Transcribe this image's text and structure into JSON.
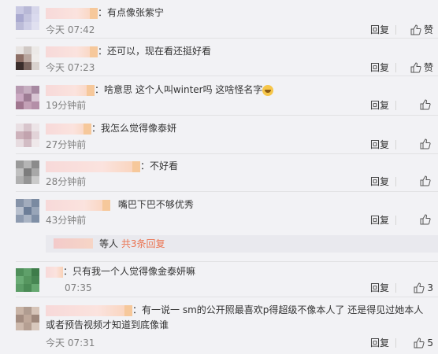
{
  "comments": [
    {
      "text": "有点像张紫宁",
      "time": "今天 07:42",
      "reply": "回复",
      "like": "赞",
      "avatar": [
        "#c8c8e2",
        "#b8b8d6",
        "#d6d6ea",
        "#a9a9cf",
        "#c4c4de",
        "#dadaee",
        "#bcbcd8",
        "#cfcfe6",
        "#e0e0f0"
      ]
    },
    {
      "text": "还可以，现在看还挺好看",
      "time": "今天 07:23",
      "reply": "回复",
      "like": "赞",
      "avatar": [
        "#e8e4e2",
        "#d0c8c4",
        "#ece9e7",
        "#8d6f66",
        "#b9a69e",
        "#efecea",
        "#3a2d2b",
        "#7a655f",
        "#d9d2ce"
      ]
    },
    {
      "text": "啥意思 这个人叫winter吗 这啥怪名字",
      "emoji": true,
      "time": "19分钟前",
      "reply": "回复",
      "like": "",
      "avatar": [
        "#b799b0",
        "#c6aec0",
        "#a789a1",
        "#caa8c1",
        "#9e7c94",
        "#d8c4d3",
        "#a0768f",
        "#c3a0b6",
        "#b48fa8"
      ]
    },
    {
      "text": "我怎么觉得像泰妍",
      "time": "27分钟前",
      "reply": "回复",
      "like": "",
      "avatar": [
        "#e9dfe3",
        "#d8c5cc",
        "#ece4e7",
        "#cdb2bb",
        "#c2a3ae",
        "#e2d3d8",
        "#e7dce0",
        "#d2bcc4",
        "#efe8ea"
      ]
    },
    {
      "text": "不好看",
      "time": "28分钟前",
      "reply": "回复",
      "like": "",
      "avatar": [
        "#9a9a9a",
        "#b5b5b5",
        "#8b8b8b",
        "#c0c0c0",
        "#7d7d7d",
        "#a8a8a8",
        "#b0b0b0",
        "#959595",
        "#cacaca"
      ]
    },
    {
      "text": "嘴巴下巴不够优秀",
      "time": "43分钟前",
      "reply": "回复",
      "like": "",
      "avatar": [
        "#8693a8",
        "#a2acbd",
        "#7a8aa1",
        "#b8c0ce",
        "#6d7e98",
        "#98a5b8",
        "#8e9bb0",
        "#aab4c4",
        "#7f8fa6"
      ]
    },
    {
      "text": "只有我一个人觉得像金泰妍嘛",
      "time": "07:35",
      "reply": "回复",
      "like": "3",
      "avatar": [
        "#4f8f5a",
        "#5fa06a",
        "#3e7c4a",
        "#6aac75",
        "#56965f",
        "#478653",
        "#5c9d67",
        "#4b8b56",
        "#66a871"
      ]
    },
    {
      "text": "有一说一 sm的公开照最喜欢p得超级不像本人了 还是得见过她本人或者预告视频才知道到底像谁",
      "time": "今天 07:31",
      "reply": "回复",
      "like": "5",
      "avatar": [
        "#c9b4a6",
        "#b09c90",
        "#d6c4b8",
        "#a38c80",
        "#bfa89a",
        "#9e877b",
        "#cdb9ac",
        "#b59f92",
        "#d8c8bd"
      ]
    }
  ],
  "subreplies": {
    "prefix": "等人",
    "link": "共3条回复"
  }
}
